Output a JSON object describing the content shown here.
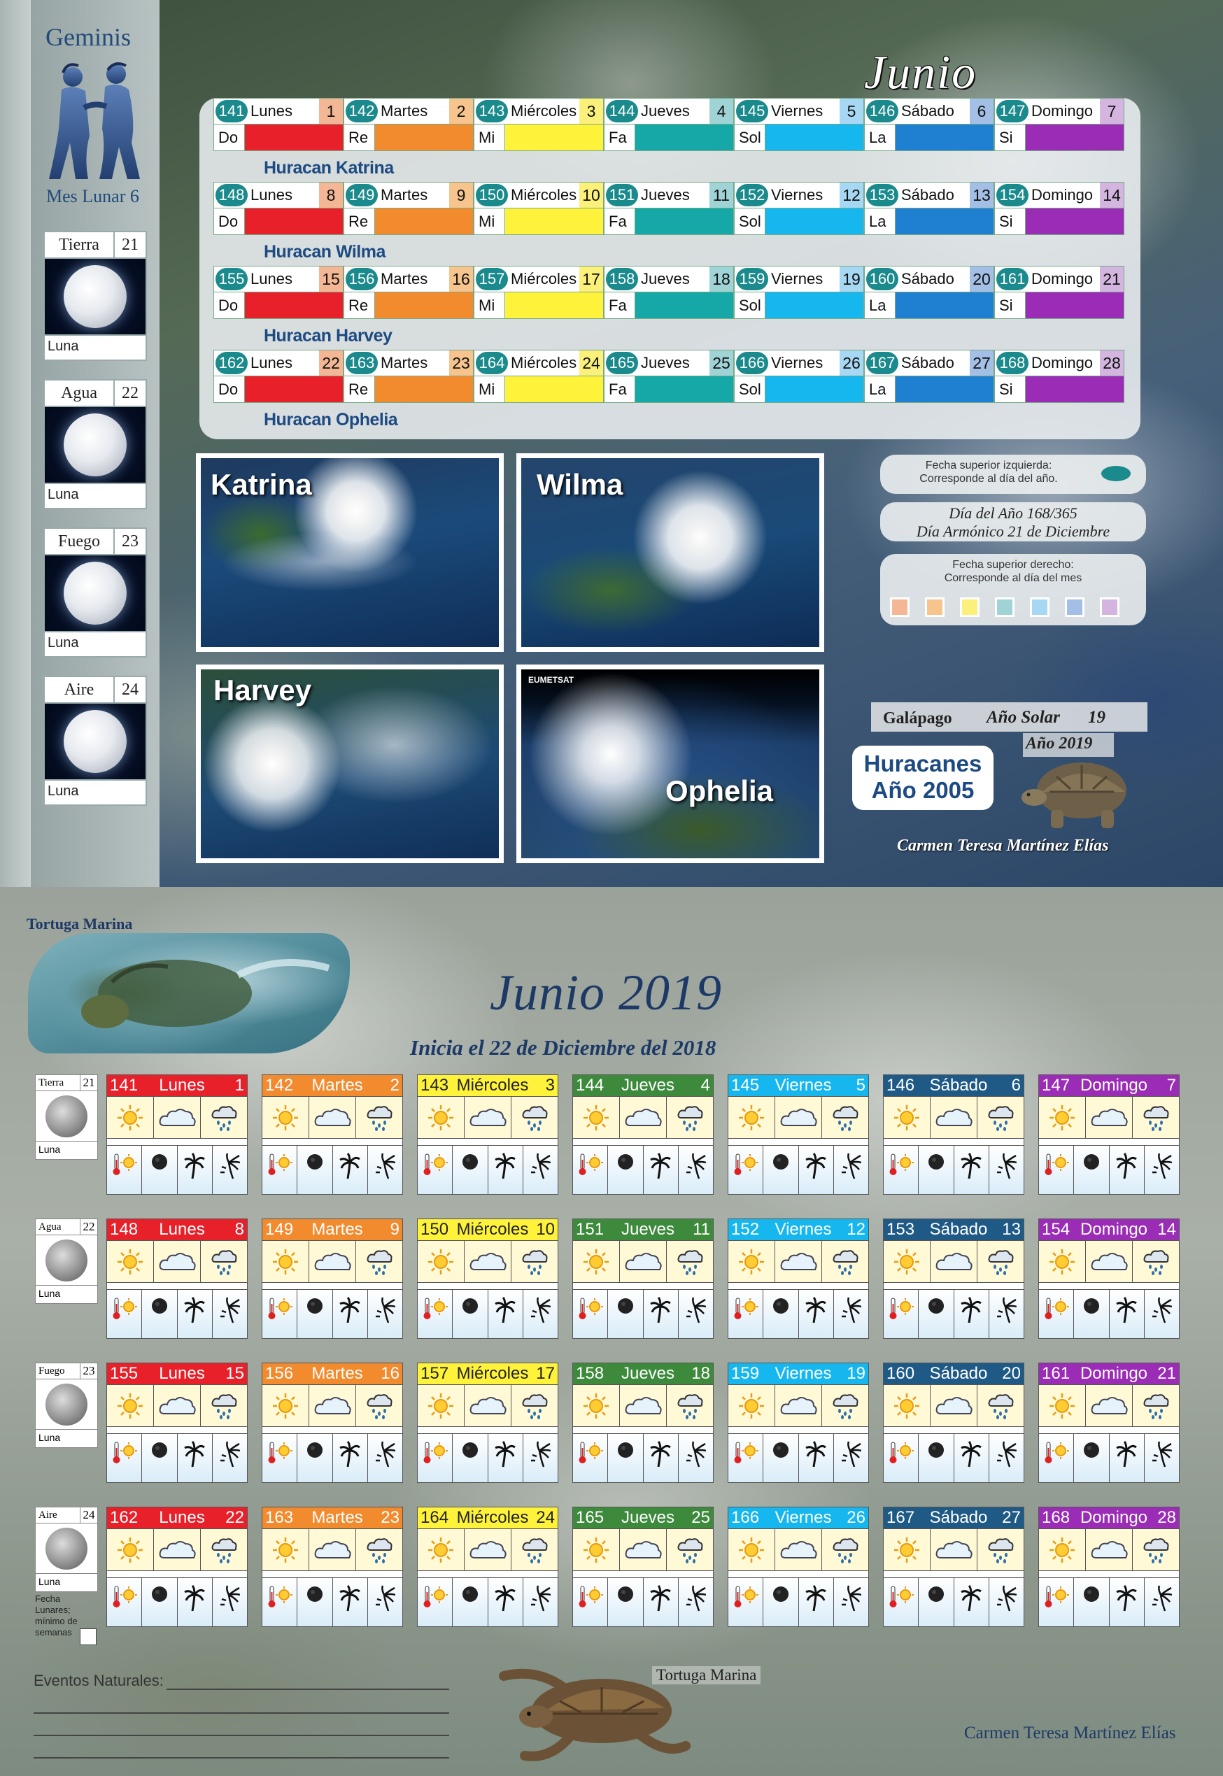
{
  "sidebar": {
    "sign": "Geminis",
    "mes_lunar": "Mes Lunar 6",
    "moons": [
      {
        "element": "Tierra",
        "number": "21",
        "label": "Luna"
      },
      {
        "element": "Agua",
        "number": "22",
        "label": "Luna"
      },
      {
        "element": "Fuego",
        "number": "23",
        "label": "Luna"
      },
      {
        "element": "Aire",
        "number": "24",
        "label": "Luna"
      }
    ]
  },
  "month_title": "Junio",
  "day_labels": [
    "Do",
    "Re",
    "Mi",
    "Fa",
    "Sol",
    "La",
    "Si"
  ],
  "day_colors": [
    "#e8202a",
    "#f28a2e",
    "#fff23a",
    "#16a8a6",
    "#16b6ee",
    "#1f7fd0",
    "#9a2cb6"
  ],
  "weeks": [
    {
      "days": [
        {
          "doy": "141",
          "name": "Lunes",
          "day": "1"
        },
        {
          "doy": "142",
          "name": "Martes",
          "day": "2"
        },
        {
          "doy": "143",
          "name": "Miércoles",
          "day": "3"
        },
        {
          "doy": "144",
          "name": "Jueves",
          "day": "4"
        },
        {
          "doy": "145",
          "name": "Viernes",
          "day": "5"
        },
        {
          "doy": "146",
          "name": "Sábado",
          "day": "6"
        },
        {
          "doy": "147",
          "name": "Domingo",
          "day": "7"
        }
      ],
      "hurricane": "Huracan Katrina"
    },
    {
      "days": [
        {
          "doy": "148",
          "name": "Lunes",
          "day": "8"
        },
        {
          "doy": "149",
          "name": "Martes",
          "day": "9"
        },
        {
          "doy": "150",
          "name": "Miércoles",
          "day": "10"
        },
        {
          "doy": "151",
          "name": "Jueves",
          "day": "11"
        },
        {
          "doy": "152",
          "name": "Viernes",
          "day": "12"
        },
        {
          "doy": "153",
          "name": "Sábado",
          "day": "13"
        },
        {
          "doy": "154",
          "name": "Domingo",
          "day": "14"
        }
      ],
      "hurricane": "Huracan Wilma"
    },
    {
      "days": [
        {
          "doy": "155",
          "name": "Lunes",
          "day": "15"
        },
        {
          "doy": "156",
          "name": "Martes",
          "day": "16"
        },
        {
          "doy": "157",
          "name": "Miércoles",
          "day": "17"
        },
        {
          "doy": "158",
          "name": "Jueves",
          "day": "18"
        },
        {
          "doy": "159",
          "name": "Viernes",
          "day": "19"
        },
        {
          "doy": "160",
          "name": "Sábado",
          "day": "20"
        },
        {
          "doy": "161",
          "name": "Domingo",
          "day": "21"
        }
      ],
      "hurricane": "Huracan Harvey"
    },
    {
      "days": [
        {
          "doy": "162",
          "name": "Lunes",
          "day": "22"
        },
        {
          "doy": "163",
          "name": "Martes",
          "day": "23"
        },
        {
          "doy": "164",
          "name": "Miércoles",
          "day": "24"
        },
        {
          "doy": "165",
          "name": "Jueves",
          "day": "25"
        },
        {
          "doy": "166",
          "name": "Viernes",
          "day": "26"
        },
        {
          "doy": "167",
          "name": "Sábado",
          "day": "27"
        },
        {
          "doy": "168",
          "name": "Domingo",
          "day": "28"
        }
      ],
      "hurricane": "Huracan Ophelia"
    }
  ],
  "photos": {
    "katrina": "Katrina",
    "wilma": "Wilma",
    "harvey": "Harvey",
    "ophelia": "Ophelia",
    "eumetsat": "EUMETSAT"
  },
  "info": {
    "top_left_line1": "Fecha superior izquierda:",
    "top_left_line2": "Corresponde al día del año.",
    "dia_del_ano": "Día del Año 168/365",
    "dia_armonico": "Día Armónico 21 de Diciembre",
    "top_right_line1": "Fecha superior derecho:",
    "top_right_line2": "Corresponde al día del mes",
    "swatch_colors": [
      "#f4b795",
      "#f6c48c",
      "#fbf07a",
      "#9fd3d6",
      "#a7d8f3",
      "#a3bfe6",
      "#d3b5df"
    ]
  },
  "galapago": {
    "word": "Galápago",
    "ano_solar": "Año Solar",
    "ano_solar_num": "19",
    "ano": "Año 2019"
  },
  "huracanes": {
    "line1": "Huracanes",
    "line2": "Año 2005"
  },
  "author": "Carmen Teresa Martínez Elías",
  "bottom": {
    "tortuga_label": "Tortuga Marina",
    "title": "Junio 2019",
    "subtitle": "Inicia el 22 de Diciembre del 2018",
    "head_colors": [
      "#e8202a",
      "#f28a2e",
      "#fff23a",
      "#3e8a3c",
      "#16b6ee",
      "#1f5a86",
      "#9a2cb6"
    ],
    "head_text_colors": [
      "#ffffff",
      "#ffffff",
      "#222222",
      "#ffffff",
      "#ffffff",
      "#ffffff",
      "#ffffff"
    ],
    "fecha_note_1": "Fecha",
    "fecha_note_2": "Lunares;",
    "fecha_note_3": "mínimo de",
    "fecha_note_4": "semanas",
    "eventos": "Eventos Naturales:",
    "tortuga_label2": "Tortuga Marina",
    "author": "Carmen Teresa Martínez Elías",
    "weeks": [
      [
        {
          "doy": "141",
          "name": "Lunes",
          "day": "1"
        },
        {
          "doy": "142",
          "name": "Martes",
          "day": "2"
        },
        {
          "doy": "143",
          "name": "Miércoles",
          "day": "3"
        },
        {
          "doy": "144",
          "name": "Jueves",
          "day": "4"
        },
        {
          "doy": "145",
          "name": "Viernes",
          "day": "5"
        },
        {
          "doy": "146",
          "name": "Sábado",
          "day": "6"
        },
        {
          "doy": "147",
          "name": "Domingo",
          "day": "7"
        }
      ],
      [
        {
          "doy": "148",
          "name": "Lunes",
          "day": "8"
        },
        {
          "doy": "149",
          "name": "Martes",
          "day": "9"
        },
        {
          "doy": "150",
          "name": "Miércoles",
          "day": "10"
        },
        {
          "doy": "151",
          "name": "Jueves",
          "day": "11"
        },
        {
          "doy": "152",
          "name": "Viernes",
          "day": "12"
        },
        {
          "doy": "153",
          "name": "Sábado",
          "day": "13"
        },
        {
          "doy": "154",
          "name": "Domingo",
          "day": "14"
        }
      ],
      [
        {
          "doy": "155",
          "name": "Lunes",
          "day": "15"
        },
        {
          "doy": "156",
          "name": "Martes",
          "day": "16"
        },
        {
          "doy": "157",
          "name": "Miércoles",
          "day": "17"
        },
        {
          "doy": "158",
          "name": "Jueves",
          "day": "18"
        },
        {
          "doy": "159",
          "name": "Viernes",
          "day": "19"
        },
        {
          "doy": "160",
          "name": "Sábado",
          "day": "20"
        },
        {
          "doy": "161",
          "name": "Domingo",
          "day": "21"
        }
      ],
      [
        {
          "doy": "162",
          "name": "Lunes",
          "day": "22"
        },
        {
          "doy": "163",
          "name": "Martes",
          "day": "23"
        },
        {
          "doy": "164",
          "name": "Miércoles",
          "day": "24"
        },
        {
          "doy": "165",
          "name": "Jueves",
          "day": "25"
        },
        {
          "doy": "166",
          "name": "Viernes",
          "day": "26"
        },
        {
          "doy": "167",
          "name": "Sábado",
          "day": "27"
        },
        {
          "doy": "168",
          "name": "Domingo",
          "day": "28"
        }
      ]
    ]
  }
}
